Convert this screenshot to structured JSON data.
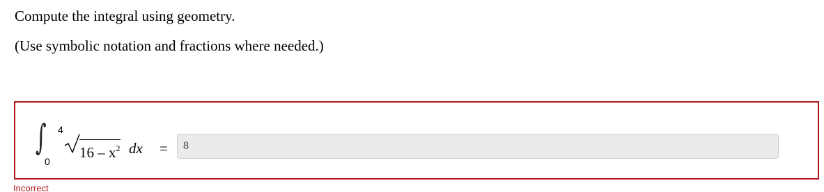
{
  "question": {
    "instruction": "Compute the integral using geometry.",
    "hint": "(Use symbolic notation and fractions where needed.)"
  },
  "expression": {
    "upper_limit": "4",
    "lower_limit": "0",
    "radicand_prefix": "16 – x",
    "exponent": "2",
    "differential": "dx",
    "equals": "="
  },
  "answer": {
    "value": "8"
  },
  "feedback": {
    "status": "Incorrect"
  },
  "colors": {
    "error_accent": "#b0171a",
    "input_background": "#ebebeb"
  }
}
